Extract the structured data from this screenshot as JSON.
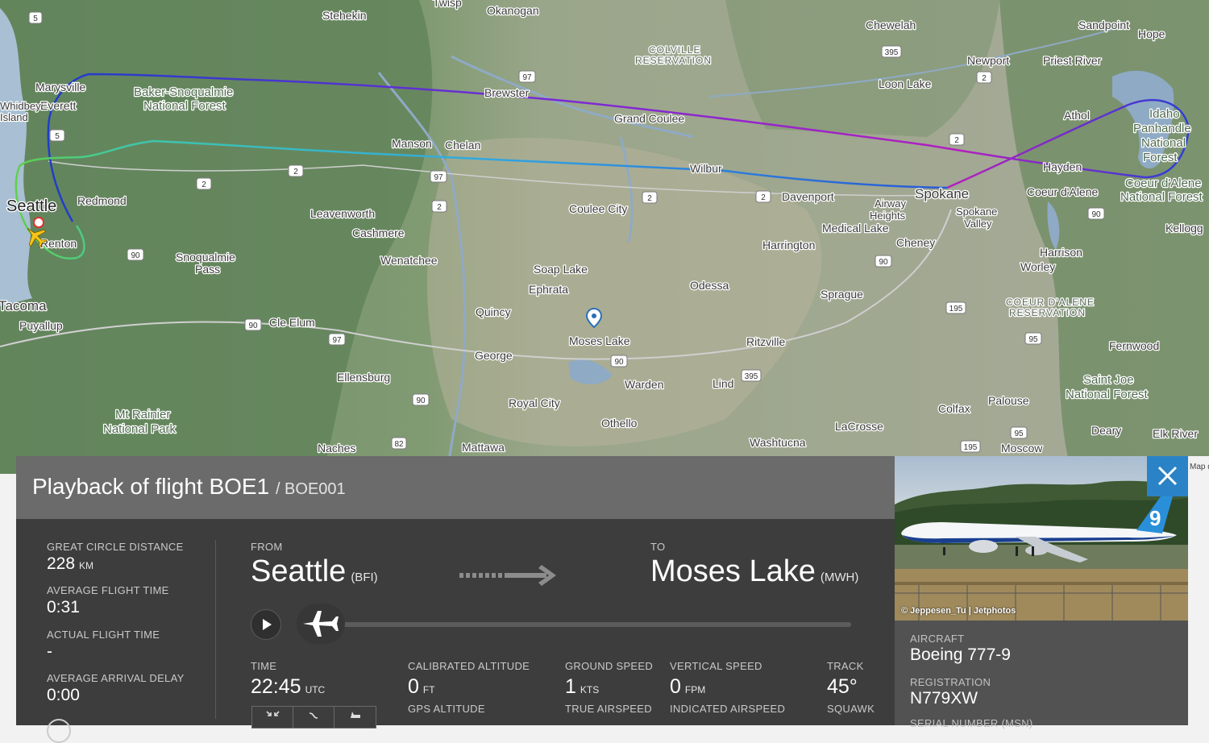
{
  "colors": {
    "panel_header": "#6b6b6b",
    "panel_body": "#3d3d3d",
    "card_bg": "#525252",
    "close_btn": "#2a83c7",
    "accent_plane": "#f5c518"
  },
  "map": {
    "labels": {
      "stehekin": "Stehekin",
      "okanogan": "Okanogan",
      "twisp": "Twisp",
      "colville": "COLVILLE",
      "reservation1": "RESERVATION",
      "chewelah": "Chewelah",
      "sandpoint": "Sandpoint",
      "hope": "Hope",
      "marysville": "Marysville",
      "everett": "Everett",
      "whidbey": "Whidbey",
      "island": "Island",
      "baker1": "Baker-Snoqualmie",
      "baker2": "National Forest",
      "brewster": "Brewster",
      "newport": "Newport",
      "priest_river": "Priest River",
      "loon_lake": "Loon Lake",
      "athol": "Athol",
      "grand_coulee": "Grand Coulee",
      "manson": "Manson",
      "chelan": "Chelan",
      "idaho1": "Idaho",
      "idaho2": "Panhandle",
      "idaho3": "National",
      "idaho4": "Forest",
      "hayden": "Hayden",
      "seattle": "Seattle",
      "redmond": "Redmond",
      "wilbur": "Wilbur",
      "spokane": "Spokane",
      "coeur": "Coeur d'Alene",
      "coeur_nf1": "Coeur d'Alene",
      "coeur_nf2": "National Forest",
      "leavenworth": "Leavenworth",
      "coulee_city": "Coulee City",
      "davenport": "Davenport",
      "airway1": "Airway",
      "airway2": "Heights",
      "spokane_valley1": "Spokane",
      "spokane_valley2": "Valley",
      "medical_lake": "Medical Lake",
      "cashmere": "Cashmere",
      "renton": "Renton",
      "kellogg": "Kellogg",
      "cheney": "Cheney",
      "harrington": "Harrington",
      "snoqualmie1": "Snoqualmie",
      "snoqualmie2": "Pass",
      "wenatchee": "Wenatchee",
      "harrison": "Harrison",
      "worley": "Worley",
      "soap_lake": "Soap Lake",
      "odessa": "Odessa",
      "ephrata": "Ephrata",
      "sprague": "Sprague",
      "tacoma": "Tacoma",
      "coeur_res1": "COEUR D'ALENE",
      "coeur_res2": "RESERVATION",
      "quincy": "Quincy",
      "cle_elum": "Cle Elum",
      "puyallup": "Puyallup",
      "moses_lake": "Moses Lake",
      "ritzville": "Ritzville",
      "fernwood": "Fernwood",
      "george": "George",
      "ellensburg": "Ellensburg",
      "warden": "Warden",
      "lind": "Lind",
      "saint_joe1": "Saint Joe",
      "saint_joe2": "National Forest",
      "palouse": "Palouse",
      "royal_city": "Royal City",
      "colfax": "Colfax",
      "rainier1": "Mt Rainier",
      "rainier2": "National Park",
      "othello": "Othello",
      "lacrosse": "LaCrosse",
      "deary": "Deary",
      "elk_river": "Elk River",
      "naches": "Naches",
      "mattawa": "Mattawa",
      "washtucna": "Washtucna",
      "moscow": "Moscow"
    },
    "shields": {
      "s5": "5",
      "s97a": "97",
      "s395a": "395",
      "s2a": "2",
      "s2b": "2",
      "s2c": "2",
      "s2d": "2",
      "s2e": "2",
      "s2f": "2",
      "s97b": "97",
      "s2g": "2",
      "s90a": "90",
      "s90b": "90",
      "s90c": "90",
      "s195a": "195",
      "s97c": "97",
      "s95a": "95",
      "s90d": "90",
      "s395b": "395",
      "s90e": "90",
      "s82": "82",
      "s195b": "195",
      "s95b": "95",
      "s5b": "5"
    },
    "credit": "Map data"
  },
  "panel": {
    "title": "Playback of flight BOE1",
    "subtitle": "/ BOE001",
    "stats": [
      {
        "label": "GREAT CIRCLE DISTANCE",
        "value": "228",
        "unit": "KM"
      },
      {
        "label": "AVERAGE FLIGHT TIME",
        "value": "0:31",
        "unit": ""
      },
      {
        "label": "ACTUAL FLIGHT TIME",
        "value": "-",
        "unit": ""
      },
      {
        "label": "AVERAGE ARRIVAL DELAY",
        "value": "0:00",
        "unit": ""
      }
    ],
    "from_label": "FROM",
    "from_city": "Seattle",
    "from_code": "(BFI)",
    "to_label": "TO",
    "to_city": "Moses Lake",
    "to_code": "(MWH)",
    "playback_progress": 0.0,
    "metrics": {
      "time_label": "TIME",
      "time_value": "22:45",
      "time_unit": "UTC",
      "cal_alt_label": "CALIBRATED ALTITUDE",
      "cal_alt_value": "0",
      "cal_alt_unit": "FT",
      "gps_alt_label": "GPS ALTITUDE",
      "ground_speed_label": "GROUND SPEED",
      "ground_speed_value": "1",
      "ground_speed_unit": "KTS",
      "true_airspeed_label": "TRUE AIRSPEED",
      "vertical_speed_label": "VERTICAL SPEED",
      "vertical_speed_value": "0",
      "vertical_speed_unit": "FPM",
      "indicated_airspeed_label": "INDICATED AIRSPEED",
      "track_label": "TRACK",
      "track_value": "45°",
      "squawk_label": "SQUAWK"
    }
  },
  "aircraft_card": {
    "photo_credit": "© Jeppesen_Tu | Jetphotos",
    "aircraft_label": "AIRCRAFT",
    "aircraft_value": "Boeing 777-9",
    "registration_label": "REGISTRATION",
    "registration_value": "N779XW",
    "serial_label": "SERIAL NUMBER (MSN)"
  }
}
